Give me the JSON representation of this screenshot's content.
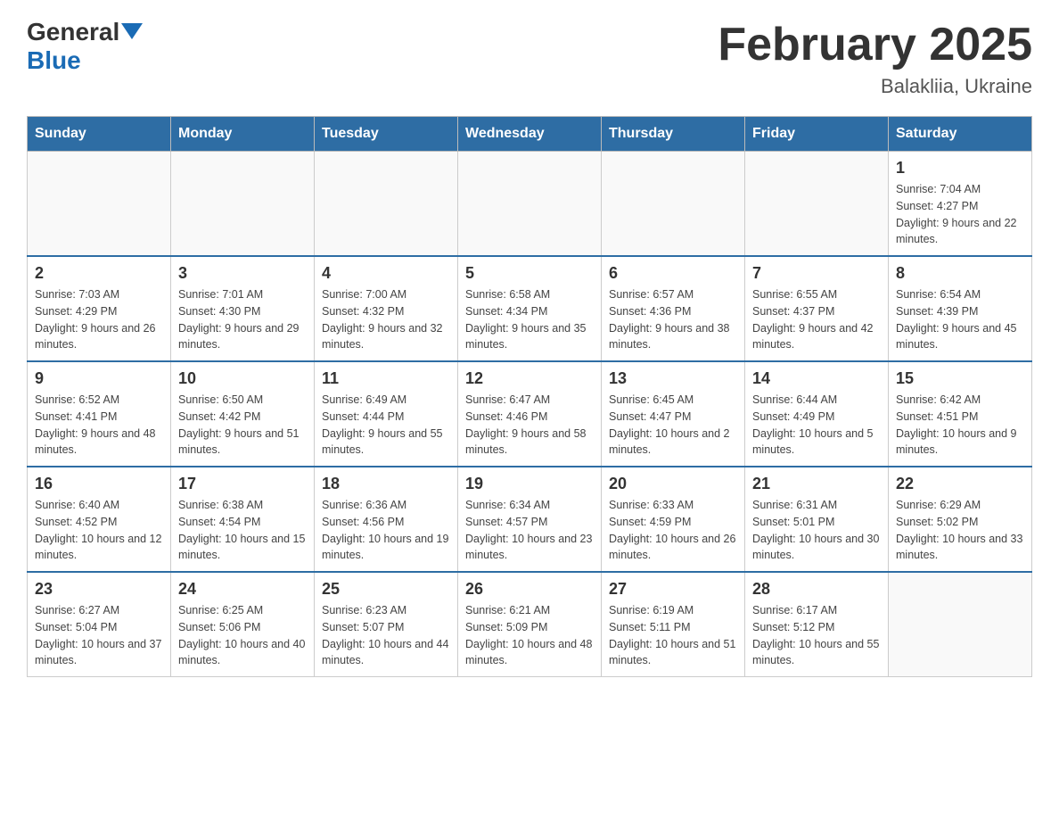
{
  "header": {
    "logo_general": "General",
    "logo_blue": "Blue",
    "month_title": "February 2025",
    "location": "Balakliia, Ukraine"
  },
  "weekdays": [
    "Sunday",
    "Monday",
    "Tuesday",
    "Wednesday",
    "Thursday",
    "Friday",
    "Saturday"
  ],
  "weeks": [
    [
      {
        "day": "",
        "sunrise": "",
        "sunset": "",
        "daylight": ""
      },
      {
        "day": "",
        "sunrise": "",
        "sunset": "",
        "daylight": ""
      },
      {
        "day": "",
        "sunrise": "",
        "sunset": "",
        "daylight": ""
      },
      {
        "day": "",
        "sunrise": "",
        "sunset": "",
        "daylight": ""
      },
      {
        "day": "",
        "sunrise": "",
        "sunset": "",
        "daylight": ""
      },
      {
        "day": "",
        "sunrise": "",
        "sunset": "",
        "daylight": ""
      },
      {
        "day": "1",
        "sunrise": "Sunrise: 7:04 AM",
        "sunset": "Sunset: 4:27 PM",
        "daylight": "Daylight: 9 hours and 22 minutes."
      }
    ],
    [
      {
        "day": "2",
        "sunrise": "Sunrise: 7:03 AM",
        "sunset": "Sunset: 4:29 PM",
        "daylight": "Daylight: 9 hours and 26 minutes."
      },
      {
        "day": "3",
        "sunrise": "Sunrise: 7:01 AM",
        "sunset": "Sunset: 4:30 PM",
        "daylight": "Daylight: 9 hours and 29 minutes."
      },
      {
        "day": "4",
        "sunrise": "Sunrise: 7:00 AM",
        "sunset": "Sunset: 4:32 PM",
        "daylight": "Daylight: 9 hours and 32 minutes."
      },
      {
        "day": "5",
        "sunrise": "Sunrise: 6:58 AM",
        "sunset": "Sunset: 4:34 PM",
        "daylight": "Daylight: 9 hours and 35 minutes."
      },
      {
        "day": "6",
        "sunrise": "Sunrise: 6:57 AM",
        "sunset": "Sunset: 4:36 PM",
        "daylight": "Daylight: 9 hours and 38 minutes."
      },
      {
        "day": "7",
        "sunrise": "Sunrise: 6:55 AM",
        "sunset": "Sunset: 4:37 PM",
        "daylight": "Daylight: 9 hours and 42 minutes."
      },
      {
        "day": "8",
        "sunrise": "Sunrise: 6:54 AM",
        "sunset": "Sunset: 4:39 PM",
        "daylight": "Daylight: 9 hours and 45 minutes."
      }
    ],
    [
      {
        "day": "9",
        "sunrise": "Sunrise: 6:52 AM",
        "sunset": "Sunset: 4:41 PM",
        "daylight": "Daylight: 9 hours and 48 minutes."
      },
      {
        "day": "10",
        "sunrise": "Sunrise: 6:50 AM",
        "sunset": "Sunset: 4:42 PM",
        "daylight": "Daylight: 9 hours and 51 minutes."
      },
      {
        "day": "11",
        "sunrise": "Sunrise: 6:49 AM",
        "sunset": "Sunset: 4:44 PM",
        "daylight": "Daylight: 9 hours and 55 minutes."
      },
      {
        "day": "12",
        "sunrise": "Sunrise: 6:47 AM",
        "sunset": "Sunset: 4:46 PM",
        "daylight": "Daylight: 9 hours and 58 minutes."
      },
      {
        "day": "13",
        "sunrise": "Sunrise: 6:45 AM",
        "sunset": "Sunset: 4:47 PM",
        "daylight": "Daylight: 10 hours and 2 minutes."
      },
      {
        "day": "14",
        "sunrise": "Sunrise: 6:44 AM",
        "sunset": "Sunset: 4:49 PM",
        "daylight": "Daylight: 10 hours and 5 minutes."
      },
      {
        "day": "15",
        "sunrise": "Sunrise: 6:42 AM",
        "sunset": "Sunset: 4:51 PM",
        "daylight": "Daylight: 10 hours and 9 minutes."
      }
    ],
    [
      {
        "day": "16",
        "sunrise": "Sunrise: 6:40 AM",
        "sunset": "Sunset: 4:52 PM",
        "daylight": "Daylight: 10 hours and 12 minutes."
      },
      {
        "day": "17",
        "sunrise": "Sunrise: 6:38 AM",
        "sunset": "Sunset: 4:54 PM",
        "daylight": "Daylight: 10 hours and 15 minutes."
      },
      {
        "day": "18",
        "sunrise": "Sunrise: 6:36 AM",
        "sunset": "Sunset: 4:56 PM",
        "daylight": "Daylight: 10 hours and 19 minutes."
      },
      {
        "day": "19",
        "sunrise": "Sunrise: 6:34 AM",
        "sunset": "Sunset: 4:57 PM",
        "daylight": "Daylight: 10 hours and 23 minutes."
      },
      {
        "day": "20",
        "sunrise": "Sunrise: 6:33 AM",
        "sunset": "Sunset: 4:59 PM",
        "daylight": "Daylight: 10 hours and 26 minutes."
      },
      {
        "day": "21",
        "sunrise": "Sunrise: 6:31 AM",
        "sunset": "Sunset: 5:01 PM",
        "daylight": "Daylight: 10 hours and 30 minutes."
      },
      {
        "day": "22",
        "sunrise": "Sunrise: 6:29 AM",
        "sunset": "Sunset: 5:02 PM",
        "daylight": "Daylight: 10 hours and 33 minutes."
      }
    ],
    [
      {
        "day": "23",
        "sunrise": "Sunrise: 6:27 AM",
        "sunset": "Sunset: 5:04 PM",
        "daylight": "Daylight: 10 hours and 37 minutes."
      },
      {
        "day": "24",
        "sunrise": "Sunrise: 6:25 AM",
        "sunset": "Sunset: 5:06 PM",
        "daylight": "Daylight: 10 hours and 40 minutes."
      },
      {
        "day": "25",
        "sunrise": "Sunrise: 6:23 AM",
        "sunset": "Sunset: 5:07 PM",
        "daylight": "Daylight: 10 hours and 44 minutes."
      },
      {
        "day": "26",
        "sunrise": "Sunrise: 6:21 AM",
        "sunset": "Sunset: 5:09 PM",
        "daylight": "Daylight: 10 hours and 48 minutes."
      },
      {
        "day": "27",
        "sunrise": "Sunrise: 6:19 AM",
        "sunset": "Sunset: 5:11 PM",
        "daylight": "Daylight: 10 hours and 51 minutes."
      },
      {
        "day": "28",
        "sunrise": "Sunrise: 6:17 AM",
        "sunset": "Sunset: 5:12 PM",
        "daylight": "Daylight: 10 hours and 55 minutes."
      },
      {
        "day": "",
        "sunrise": "",
        "sunset": "",
        "daylight": ""
      }
    ]
  ]
}
